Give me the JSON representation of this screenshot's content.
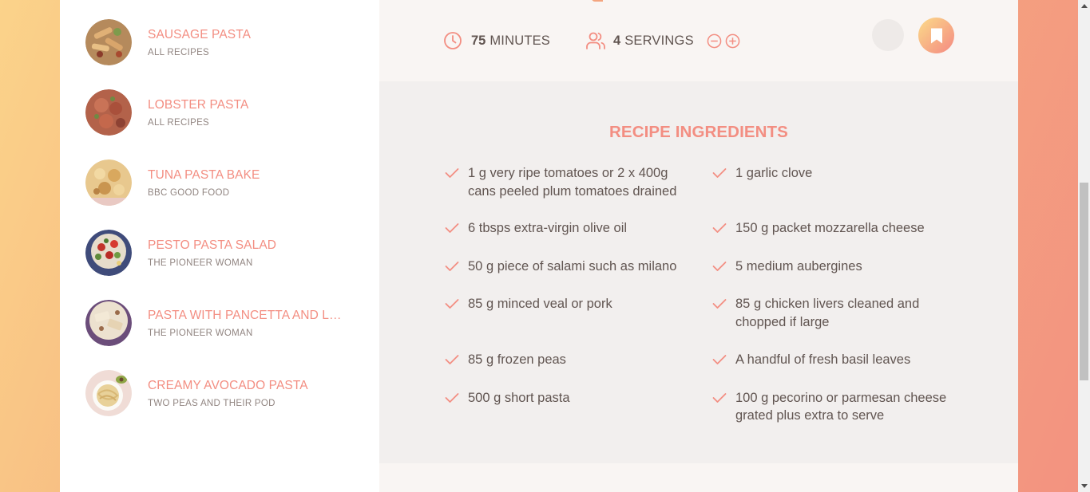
{
  "search_results": [
    {
      "title": "Sausage Pasta",
      "publisher": "All Recipes",
      "thumb": "sausage-pasta-thumb"
    },
    {
      "title": "Lobster Pasta",
      "publisher": "All Recipes",
      "thumb": "lobster-pasta-thumb"
    },
    {
      "title": "Tuna Pasta Bake",
      "publisher": "BBC Good Food",
      "thumb": "tuna-pasta-bake-thumb"
    },
    {
      "title": "Pesto Pasta Salad",
      "publisher": "The Pioneer Woman",
      "thumb": "pesto-pasta-salad-thumb"
    },
    {
      "title": "Pasta with Pancetta and Lee...",
      "publisher": "The Pioneer Woman",
      "thumb": "pasta-pancetta-thumb"
    },
    {
      "title": "Creamy Avocado Pasta",
      "publisher": "Two Peas and Their Pod",
      "thumb": "creamy-avocado-pasta-thumb"
    }
  ],
  "recipe": {
    "cooking_time": "75",
    "cooking_time_unit": "minutes",
    "servings": "4",
    "servings_unit": "servings",
    "icons": {
      "clock": "clock-icon",
      "users": "users-icon",
      "minus": "minus-circle-icon",
      "plus": "plus-circle-icon",
      "bookmark": "bookmark-icon",
      "check": "check-icon"
    },
    "ingredients_heading": "Recipe ingredients",
    "ingredients": [
      {
        "qty": "1",
        "desc": "g very ripe tomatoes or 2 x 400g cans peeled plum tomatoes drained"
      },
      {
        "qty": "1",
        "desc": "garlic clove"
      },
      {
        "qty": "6",
        "desc": "tbsps extra-virgin olive oil"
      },
      {
        "qty": "150",
        "desc": "g packet mozzarella cheese"
      },
      {
        "qty": "50",
        "desc": "g piece of salami such as milano"
      },
      {
        "qty": "5",
        "desc": "medium aubergines"
      },
      {
        "qty": "85",
        "desc": "g minced veal or pork"
      },
      {
        "qty": "85",
        "desc": "g chicken livers cleaned and chopped if large"
      },
      {
        "qty": "85",
        "desc": "g frozen peas"
      },
      {
        "qty": "",
        "desc": "A handful of fresh basil leaves"
      },
      {
        "qty": "500",
        "desc": "g short pasta"
      },
      {
        "qty": "100",
        "desc": "g pecorino or parmesan cheese grated plus extra to serve"
      }
    ]
  },
  "colors": {
    "accent": "#f38e82",
    "text": "#615551",
    "muted": "#918581",
    "grad_start": "#fbdb89",
    "grad_end": "#f48982"
  }
}
